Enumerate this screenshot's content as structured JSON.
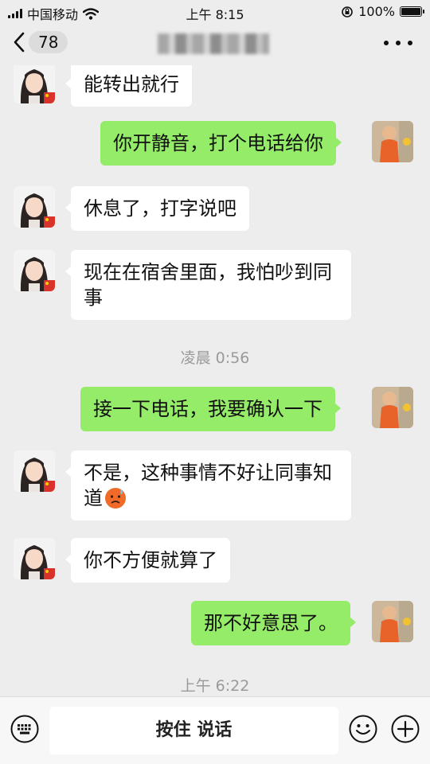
{
  "status_bar": {
    "carrier": "中国移动",
    "time": "上午 8:15",
    "battery": "100%"
  },
  "header": {
    "unread_count": "78",
    "contact_name": "·"
  },
  "messages": [
    {
      "side": "in",
      "text": "能转出就行"
    },
    {
      "side": "out",
      "text": "你开静音，打个电话给你"
    },
    {
      "side": "in",
      "text": "休息了，打字说吧"
    },
    {
      "side": "in",
      "text": "现在在宿舍里面，我怕吵到同事"
    },
    {
      "timestamp": "凌晨 0:56"
    },
    {
      "side": "out",
      "text": "接一下电话，我要确认一下"
    },
    {
      "side": "in",
      "text": "不是，这种事情不好让同事知道",
      "emoji": "anxious-sweat-face"
    },
    {
      "side": "in",
      "text": "你不方便就算了"
    },
    {
      "side": "out",
      "text": "那不好意思了。"
    },
    {
      "timestamp": "上午 6:22"
    }
  ],
  "input_bar": {
    "hold_to_talk": "按住 说话"
  },
  "colors": {
    "outgoing_bubble": "#95ec69",
    "incoming_bubble": "#ffffff",
    "background": "#ededed"
  }
}
